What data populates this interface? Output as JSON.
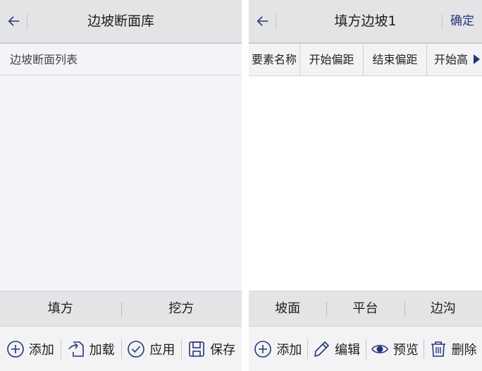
{
  "left": {
    "title": "边坡断面库",
    "list_header": "边坡断面列表",
    "tabs": [
      "填方",
      "挖方"
    ],
    "actions": [
      {
        "label": "添加",
        "icon": "add-circle-icon"
      },
      {
        "label": "加载",
        "icon": "load-icon"
      },
      {
        "label": "应用",
        "icon": "check-circle-icon"
      },
      {
        "label": "保存",
        "icon": "save-icon"
      }
    ]
  },
  "right": {
    "title": "填方边坡1",
    "confirm_label": "确定",
    "columns": [
      "要素名称",
      "开始偏距",
      "结束偏距",
      "开始高"
    ],
    "tabs": [
      "坡面",
      "平台",
      "边沟"
    ],
    "actions": [
      {
        "label": "添加",
        "icon": "add-circle-icon"
      },
      {
        "label": "编辑",
        "icon": "pencil-icon"
      },
      {
        "label": "预览",
        "icon": "eye-icon"
      },
      {
        "label": "删除",
        "icon": "trash-icon"
      }
    ]
  },
  "colors": {
    "accent": "#25357a",
    "titlebar_bg": "#e4e4e6",
    "panel_bg": "#f3f4f8"
  }
}
